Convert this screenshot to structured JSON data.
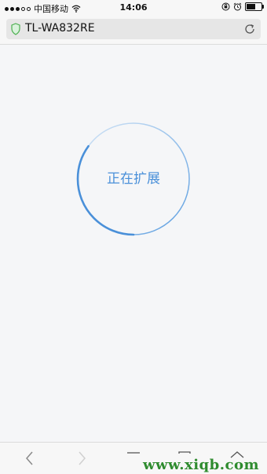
{
  "status_bar": {
    "carrier": "中国移动",
    "time": "14:06",
    "battery_level": 0.7,
    "icons": [
      "signal-dots-icon",
      "wifi-icon",
      "orientation-lock-icon",
      "alarm-icon",
      "battery-icon"
    ]
  },
  "address_bar": {
    "text": "TL-WA832RE",
    "secure_icon": "shield-icon",
    "reload_icon": "reload-icon"
  },
  "main": {
    "status_text": "正在扩展",
    "progress": 0.35,
    "accent_color": "#4a90d9"
  },
  "toolbar": {
    "icons": [
      "back-icon",
      "forward-icon",
      "share-icon",
      "bookmarks-icon",
      "tabs-icon"
    ]
  },
  "watermark": {
    "text": "www.xiqb.com",
    "color": "#2e8b2e"
  }
}
